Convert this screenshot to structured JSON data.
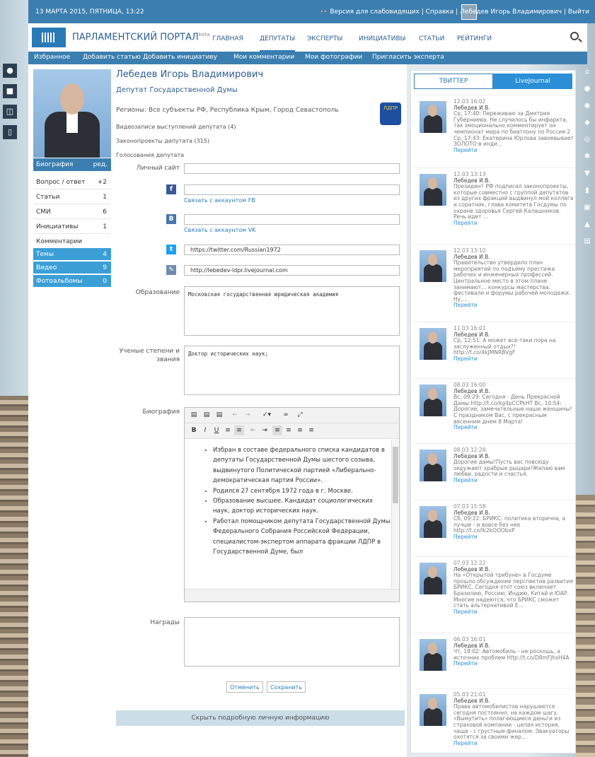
{
  "topbar": {
    "date": "13 МАРТА 2015, ПЯТНИЦА, 13:22",
    "right": "👓 Версия для слабовидящих  |  Справка  |       Лебедев Игорь Владимирович  |  Выйти"
  },
  "header": {
    "site_title": "ПАРЛАМЕНТСКИЙ ПОРТАЛ",
    "beta": "beta",
    "nav": [
      "ГЛАВНАЯ",
      "ДЕПУТАТЫ",
      "ЭКСПЕРТЫ",
      "ИНИЦИАТИВЫ",
      "СТАТЬИ",
      "РЕЙТИНГИ"
    ],
    "active_nav": "ДЕПУТАТЫ"
  },
  "subnav": [
    "Избранное",
    "Добавить статью",
    "Добавить инициативу",
    "Мои комментарии",
    "Мои фотографии",
    "Пригласить эксперта"
  ],
  "sidebar": {
    "bio_label": "Биография",
    "edit_label": "ред.",
    "items": [
      {
        "label": "Вопрос / ответ",
        "count": "+2"
      },
      {
        "label": "Статьи",
        "count": "1"
      },
      {
        "label": "СМИ",
        "count": "6"
      },
      {
        "label": "Инициативы",
        "count": "1"
      },
      {
        "label": "Комментарии",
        "count": ""
      }
    ],
    "blue_items": [
      {
        "label": "Темы",
        "count": "4"
      },
      {
        "label": "Видео",
        "count": "9"
      },
      {
        "label": "Фотоальбомы",
        "count": "0"
      }
    ]
  },
  "profile": {
    "name": "Лебедев Игорь Владимирович",
    "title": "Депутат Государственной Думы",
    "regions": "Регионы: Все субъекты РФ, Республика Крым, Город Севастополь",
    "videos": "Видеозаписи выступлений депутата (4)",
    "bills": "Законопроекты депутата (315)",
    "votes": "Голосования депутата",
    "party": "ЛДПР"
  },
  "form": {
    "site_label": "Личный сайт",
    "site_value": "",
    "fb_value": "",
    "fb_link": "Связать с аккаунтом FB",
    "vk_value": "",
    "vk_link": "Связать с аккаунтом VK",
    "twitter_value": "https://twitter.com/Russian1972",
    "lj_value": "http://lebedev-ldpr.livejournal.com",
    "edu_label": "Образование",
    "edu_value": "Московская государственная юридическая академия",
    "degree_label": "Ученые степени и звания",
    "degree_value": "Доктор исторических наук;",
    "bio_label": "Биография",
    "awards_label": "Награды",
    "awards_value": "",
    "cancel": "Отменить",
    "save": "Сохранить",
    "hide": "Скрыть подробную личную информацию"
  },
  "bio_items": [
    "Избран в составе федерального списка кандидатов в депутаты Государственной Думы шестого созыва, выдвинутого Политической партией «Либерально-демократическая партия России».",
    "Родился 27 сентября 1972 года в г. Москве.",
    "Образование высшее. Кандидат социологических наук, доктор исторических наук.",
    "Работал помощником депутата Государственной Думы Федерального Собрания Российской Федерации, специалистом-экспертом аппарата фракции ЛДПР в Государственной Думе, был"
  ],
  "feed": {
    "tab_twitter": "ТВИТТЕР",
    "tab_lj": "LiveJournal",
    "link": "Перейти",
    "posts": [
      {
        "date": "12.03 16:02",
        "author": "Лебедев И.В.",
        "text": "Ср, 17:40: Переживаю за Дмитрия Губерниева. Не случилось бы инфаркта, так эмоционально комментирует он чемпионат мира по биатлону по Россия-2 Ср, 17:43: Екатерина Юрлова завоевывает ЗОЛОТО в инди..."
      },
      {
        "date": "12.03 13:13",
        "author": "Лебедев И.В.",
        "text": "Президент РФ подписал законопроекты, которые совместно с группой депутатов из других фракций выдвинул мой коллега и соратник, глава комитета Госдумы по охране здоровья Сергей Калашников. Речь идет ..."
      },
      {
        "date": "12.03 13:10",
        "author": "Лебедев И.В.",
        "text": "Правительство утвердило план мероприятий по подъему престижа рабочих и инженерных профессий. Центральное место в этом плане занимают... конкурсы мастерства, фестивали и форумы рабочей молодежи. Ну,..."
      },
      {
        "date": "11.03 16:01",
        "author": "Лебедев И.В.",
        "text": "Ср, 12:51: А может все-таки пора на заслуженный отдых?! http://t.co/4kJMNRBVgF"
      },
      {
        "date": "08.03 16:00",
        "author": "Лебедев И.В.",
        "text": "Вс, 09:29: Сегодня - День Прекрасной Дамы http://t.co/kg4pCCPkHT Вс, 10:54: Дорогие, замечательные наши женщины! С праздником Вас, с прекрасным весенним днем 8 Марта!"
      },
      {
        "date": "08.03 12:28",
        "author": "Лебедев И.В.",
        "text": "Дорогие дамы!Пусть вас повсюду окружают храбрые рыцари!Желаю вам любви, радости и счастья."
      },
      {
        "date": "07.03 15:58",
        "author": "Лебедев И.В.",
        "text": "Сб, 09:22: БРИКС: политика вторична, а лучше - и вовсе без нее http://t.co/lk2kOOObxP"
      },
      {
        "date": "07.03 12:22",
        "author": "Лебедев И.В.",
        "text": "На «Открытой трибуне» в Госдуме прошло обсуждение перспектив развития БРИКС. Сегодня этот союз включает Бразилию, Россию, Индию, Китай и ЮАР. Многие надеются, что БРИКС сможет стать альтернативой Е..."
      },
      {
        "date": "06.03 16:01",
        "author": "Лебедев И.В.",
        "text": "Чт, 18:02: Автомобиль - не роскошь, а источник проблем http://t.co/D8mFJhsH4A"
      },
      {
        "date": "05.03 21:01",
        "author": "Лебедев И.В.",
        "text": "Права автомобилистов нарушаются сегодня постоянно, на каждом шагу. «Вымутить» полагающиеся деньги из страховой компании - целая история, чаще - с грустным финалом. Эвакуаторы охотятся за своими жер..."
      }
    ]
  }
}
